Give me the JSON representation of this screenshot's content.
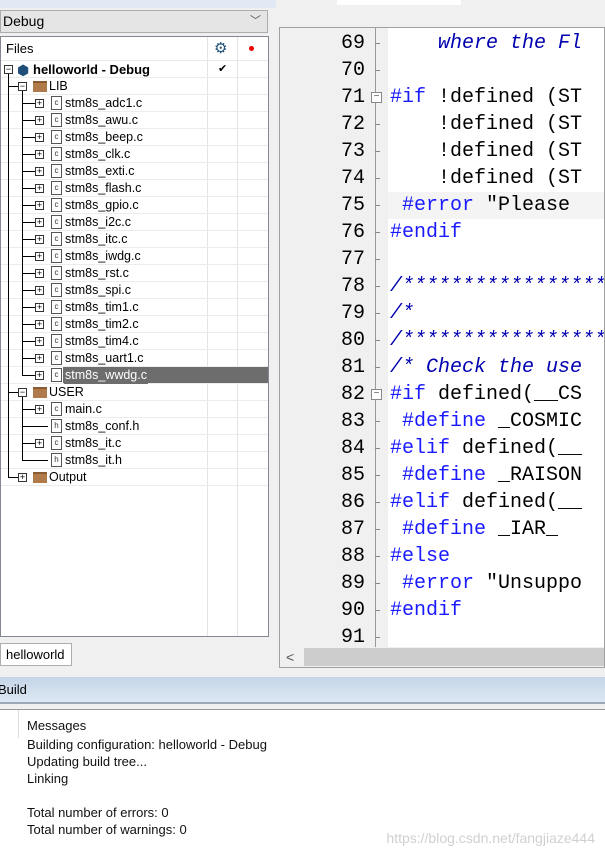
{
  "config": {
    "selected": "Debug"
  },
  "tree": {
    "header": {
      "label": "Files",
      "settings_icon": "gear-icon",
      "status_icon": "red-dot-icon"
    },
    "project": {
      "label": "helloworld - Debug",
      "check": "✔"
    },
    "groups": [
      {
        "label": "LIB",
        "files": [
          "stm8s_adc1.c",
          "stm8s_awu.c",
          "stm8s_beep.c",
          "stm8s_clk.c",
          "stm8s_exti.c",
          "stm8s_flash.c",
          "stm8s_gpio.c",
          "stm8s_i2c.c",
          "stm8s_itc.c",
          "stm8s_iwdg.c",
          "stm8s_rst.c",
          "stm8s_spi.c",
          "stm8s_tim1.c",
          "stm8s_tim2.c",
          "stm8s_tim4.c",
          "stm8s_uart1.c",
          "stm8s_wwdg.c"
        ]
      },
      {
        "label": "USER",
        "files": [
          "main.c",
          "stm8s_conf.h",
          "stm8s_it.c",
          "stm8s_it.h"
        ]
      },
      {
        "label": "Output",
        "files": []
      }
    ],
    "selected_file": "stm8s_wwdg.c"
  },
  "workspace_tab": "helloworld",
  "editor": {
    "lines": [
      {
        "n": "69",
        "segs": [
          [
            "    where the Fl",
            "cm"
          ]
        ]
      },
      {
        "n": "70",
        "segs": []
      },
      {
        "n": "71",
        "fold": true,
        "segs": [
          [
            "#if",
            "kw"
          ],
          [
            " !defined (ST",
            "tx"
          ]
        ]
      },
      {
        "n": "72",
        "segs": [
          [
            "    !defined (ST",
            "tx"
          ]
        ]
      },
      {
        "n": "73",
        "segs": [
          [
            "    !defined (ST",
            "tx"
          ]
        ]
      },
      {
        "n": "74",
        "segs": [
          [
            "    !defined (ST",
            "tx"
          ]
        ]
      },
      {
        "n": "75",
        "cur": true,
        "segs": [
          [
            " #error",
            "kw"
          ],
          [
            " \"Please ",
            "tx"
          ]
        ]
      },
      {
        "n": "76",
        "tick": true,
        "segs": [
          [
            "#endif",
            "kw"
          ]
        ]
      },
      {
        "n": "77",
        "segs": []
      },
      {
        "n": "78",
        "segs": [
          [
            "/*****************",
            "cm"
          ]
        ]
      },
      {
        "n": "79",
        "segs": [
          [
            "/*",
            "cm"
          ]
        ]
      },
      {
        "n": "80",
        "segs": [
          [
            "/*****************",
            "cm"
          ]
        ]
      },
      {
        "n": "81",
        "segs": [
          [
            "/* Check the use",
            "cm"
          ]
        ]
      },
      {
        "n": "82",
        "fold": true,
        "segs": [
          [
            "#if",
            "kw"
          ],
          [
            " defined(__CS",
            "tx"
          ]
        ]
      },
      {
        "n": "83",
        "segs": [
          [
            " #define",
            "kw"
          ],
          [
            " _COSMIC",
            "tx"
          ]
        ]
      },
      {
        "n": "84",
        "segs": [
          [
            "#elif",
            "kw"
          ],
          [
            " defined(__",
            "tx"
          ]
        ]
      },
      {
        "n": "85",
        "segs": [
          [
            " #define",
            "kw"
          ],
          [
            " _RAISON",
            "tx"
          ]
        ]
      },
      {
        "n": "86",
        "segs": [
          [
            "#elif",
            "kw"
          ],
          [
            " defined(__",
            "tx"
          ]
        ]
      },
      {
        "n": "87",
        "segs": [
          [
            " #define",
            "kw"
          ],
          [
            " _IAR_",
            "tx"
          ]
        ]
      },
      {
        "n": "88",
        "segs": [
          [
            "#else",
            "kw"
          ]
        ]
      },
      {
        "n": "89",
        "segs": [
          [
            " #error",
            "kw"
          ],
          [
            " \"Unsuppo",
            "tx"
          ]
        ]
      },
      {
        "n": "90",
        "tick": true,
        "segs": [
          [
            "#endif",
            "kw"
          ]
        ]
      },
      {
        "n": "91",
        "segs": []
      }
    ]
  },
  "build": {
    "title": "Build",
    "header": "Messages",
    "messages": [
      "Building configuration: helloworld - Debug",
      "Updating build tree...",
      "Linking",
      "",
      "Total number of errors: 0",
      "Total number of warnings: 0"
    ]
  },
  "watermark": "https://blog.csdn.net/fangjiaze444"
}
